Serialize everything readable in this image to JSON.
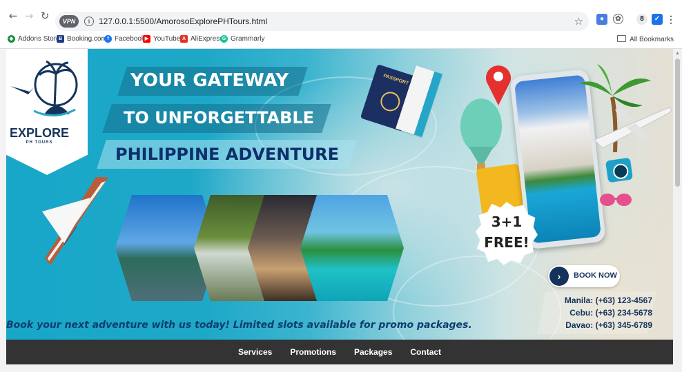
{
  "browser": {
    "url": "127.0.0.1:5500/AmorosoExplorePHTours.html",
    "vpn_label": "VPN",
    "profile_initial": "8",
    "bookmarks": [
      "Addons Store",
      "Booking.com",
      "Facebook",
      "YouTube",
      "AliExpress",
      "Grammarly"
    ],
    "all_bookmarks": "All Bookmarks"
  },
  "hero": {
    "logo_title": "EXPLORE",
    "logo_subtitle": "PH TOURS",
    "headline_1": "YOUR GATEWAY",
    "headline_2": "TO UNFORGETTABLE",
    "headline_3": "PHILIPPINE ADVENTURE",
    "passport_label": "PASSPORT",
    "promo_line1": "3+1",
    "promo_line2": "FREE!",
    "book_now": "BOOK NOW",
    "phones": [
      "Manila: (+63) 123-4567",
      "Cebu: (+63) 234-5678",
      "Davao: (+63) 345-6789"
    ],
    "tagline": "Book your next adventure with us today! Limited slots available for promo packages."
  },
  "nav": {
    "items": [
      "Services",
      "Promotions",
      "Packages",
      "Contact"
    ]
  }
}
